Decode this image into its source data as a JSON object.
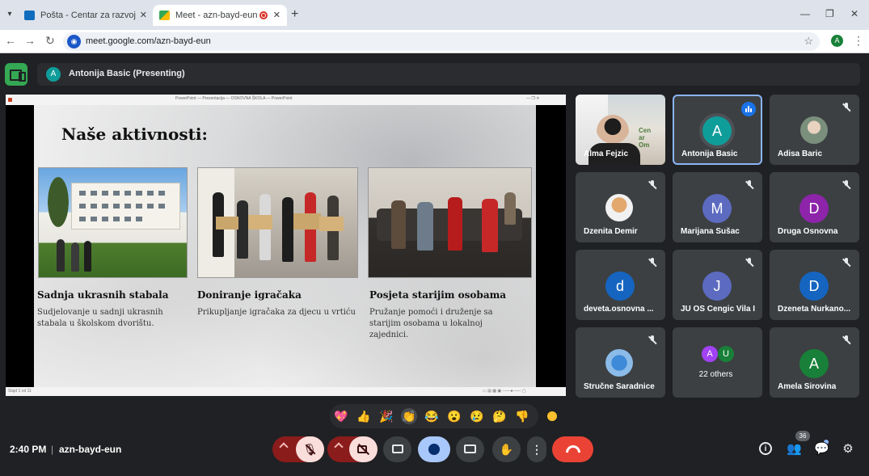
{
  "browser": {
    "tabs": [
      {
        "label": "Pošta - Centar za razvoj omlad"
      },
      {
        "label": "Meet - azn-bayd-eun"
      }
    ],
    "url": "meet.google.com/azn-bayd-eun",
    "profile_initial": "A"
  },
  "meet": {
    "presenter_initial": "A",
    "presenting_text": "Antonija Basic (Presenting)",
    "time": "2:40 PM",
    "separator": "|",
    "meeting_code": "azn-bayd-eun",
    "people_count": "36"
  },
  "slide": {
    "title": "Naše aktivnosti:",
    "window_title": "PowerPoint — Prezentacija — OSNOVNA ŠKOLA — PowerPoint",
    "status_left": "Slajd 1 od 11",
    "items": [
      {
        "title": "Sadnja ukrasnih stabala",
        "text": "Sudjelovanje u sadnji ukrasnih stabala u školskom dvorištu."
      },
      {
        "title": "Doniranje igračaka",
        "text": "Prikupljanje igračaka za djecu u vrtiću"
      },
      {
        "title": "Posjeta starijim osobama",
        "text": "Pružanje pomoći i druženje sa starijim osobama u lokalnoj zajednici."
      }
    ]
  },
  "participants": [
    {
      "name": "Alma Fejzic",
      "video": true
    },
    {
      "name": "Antonija Basic",
      "initial": "A",
      "color": "#0f9d9a",
      "speaking": true
    },
    {
      "name": "Adisa Baric",
      "photo": true,
      "muted": true
    },
    {
      "name": "Dzenita Demir",
      "photo": true,
      "muted": true
    },
    {
      "name": "Marijana Sušac",
      "initial": "M",
      "color": "#5c6bc0",
      "muted": true
    },
    {
      "name": "Druga Osnovna",
      "initial": "D",
      "color": "#8e24aa",
      "muted": true
    },
    {
      "name": "deveta.osnovna ...",
      "initial": "d",
      "color": "#1565c0",
      "muted": true
    },
    {
      "name": "JU OS Cengic Vila I",
      "initial": "J",
      "color": "#5c6bc0",
      "muted": true
    },
    {
      "name": "Dzeneta Nurkano...",
      "initial": "D",
      "color": "#1565c0",
      "muted": true
    },
    {
      "name": "Stručne Saradnice",
      "photo": true,
      "muted": true
    },
    {
      "name": "22 others",
      "initials": [
        "A",
        "U"
      ]
    },
    {
      "name": "Amela Sirovina",
      "initial": "A",
      "color": "#188038",
      "muted": true
    }
  ],
  "reactions": [
    "💖",
    "👍",
    "🎉",
    "👏",
    "😂",
    "😮",
    "😢",
    "🤔",
    "👎"
  ]
}
